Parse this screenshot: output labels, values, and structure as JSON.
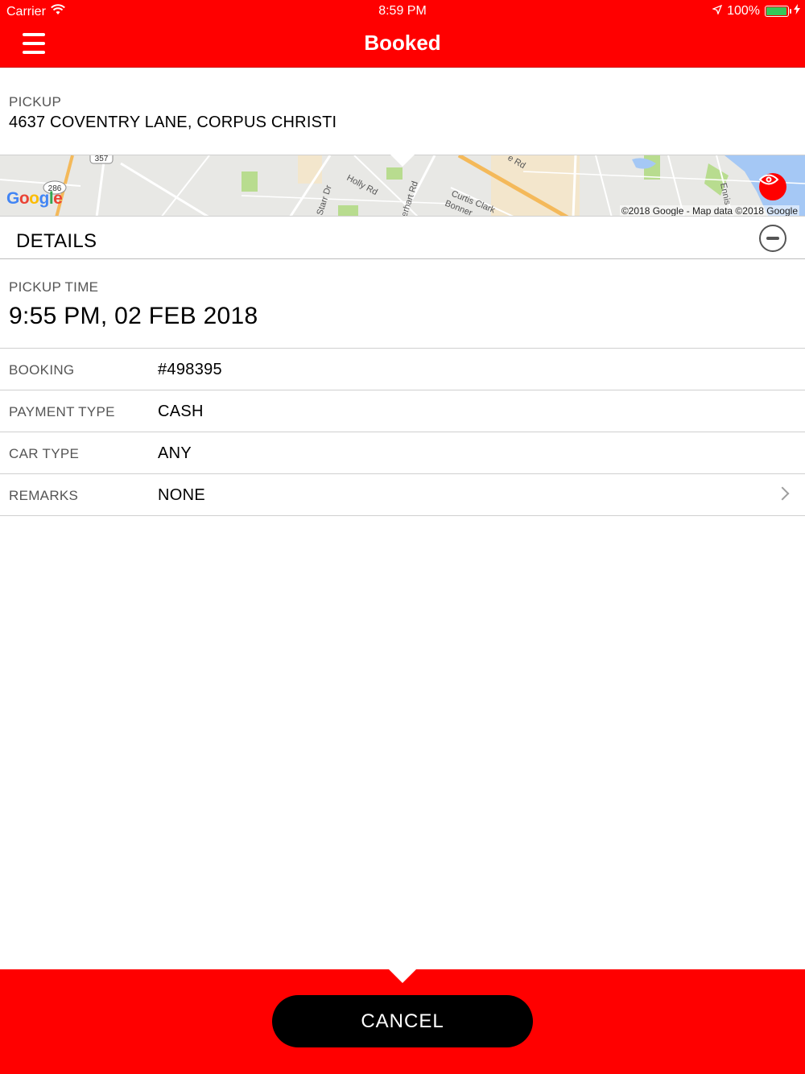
{
  "status_bar": {
    "carrier": "Carrier",
    "time": "8:59 PM",
    "battery": "100%",
    "battery_level": 1.0
  },
  "header": {
    "title": "Booked",
    "menu_icon": "hamburger-menu-icon"
  },
  "pickup": {
    "label": "PICKUP",
    "address": "4637 COVENTRY LANE, CORPUS CHRISTI"
  },
  "map": {
    "attribution": "©2018 Google - Map data ©2018 Google",
    "logo": "Google",
    "street_labels": [
      "Holly Rd",
      "Starr Dr",
      "erhart Rd",
      "Curtis Clark",
      "Bonner",
      "Ennis",
      "e Rd"
    ],
    "route_labels": [
      "357",
      "286"
    ],
    "eye_icon": "eye-icon"
  },
  "details": {
    "title": "DETAILS",
    "collapse_icon": "minus-circle-icon"
  },
  "pickup_time": {
    "label": "PICKUP TIME",
    "value": "9:55 PM, 02 FEB 2018"
  },
  "rows": [
    {
      "label": "BOOKING",
      "value": "#498395"
    },
    {
      "label": "PAYMENT TYPE",
      "value": "CASH"
    },
    {
      "label": "CAR TYPE",
      "value": "ANY"
    },
    {
      "label": "REMARKS",
      "value": "NONE"
    }
  ],
  "footer": {
    "cancel_label": "CANCEL"
  },
  "colors": {
    "brand": "#ff0000",
    "button": "#000000",
    "battery": "#34c759"
  }
}
